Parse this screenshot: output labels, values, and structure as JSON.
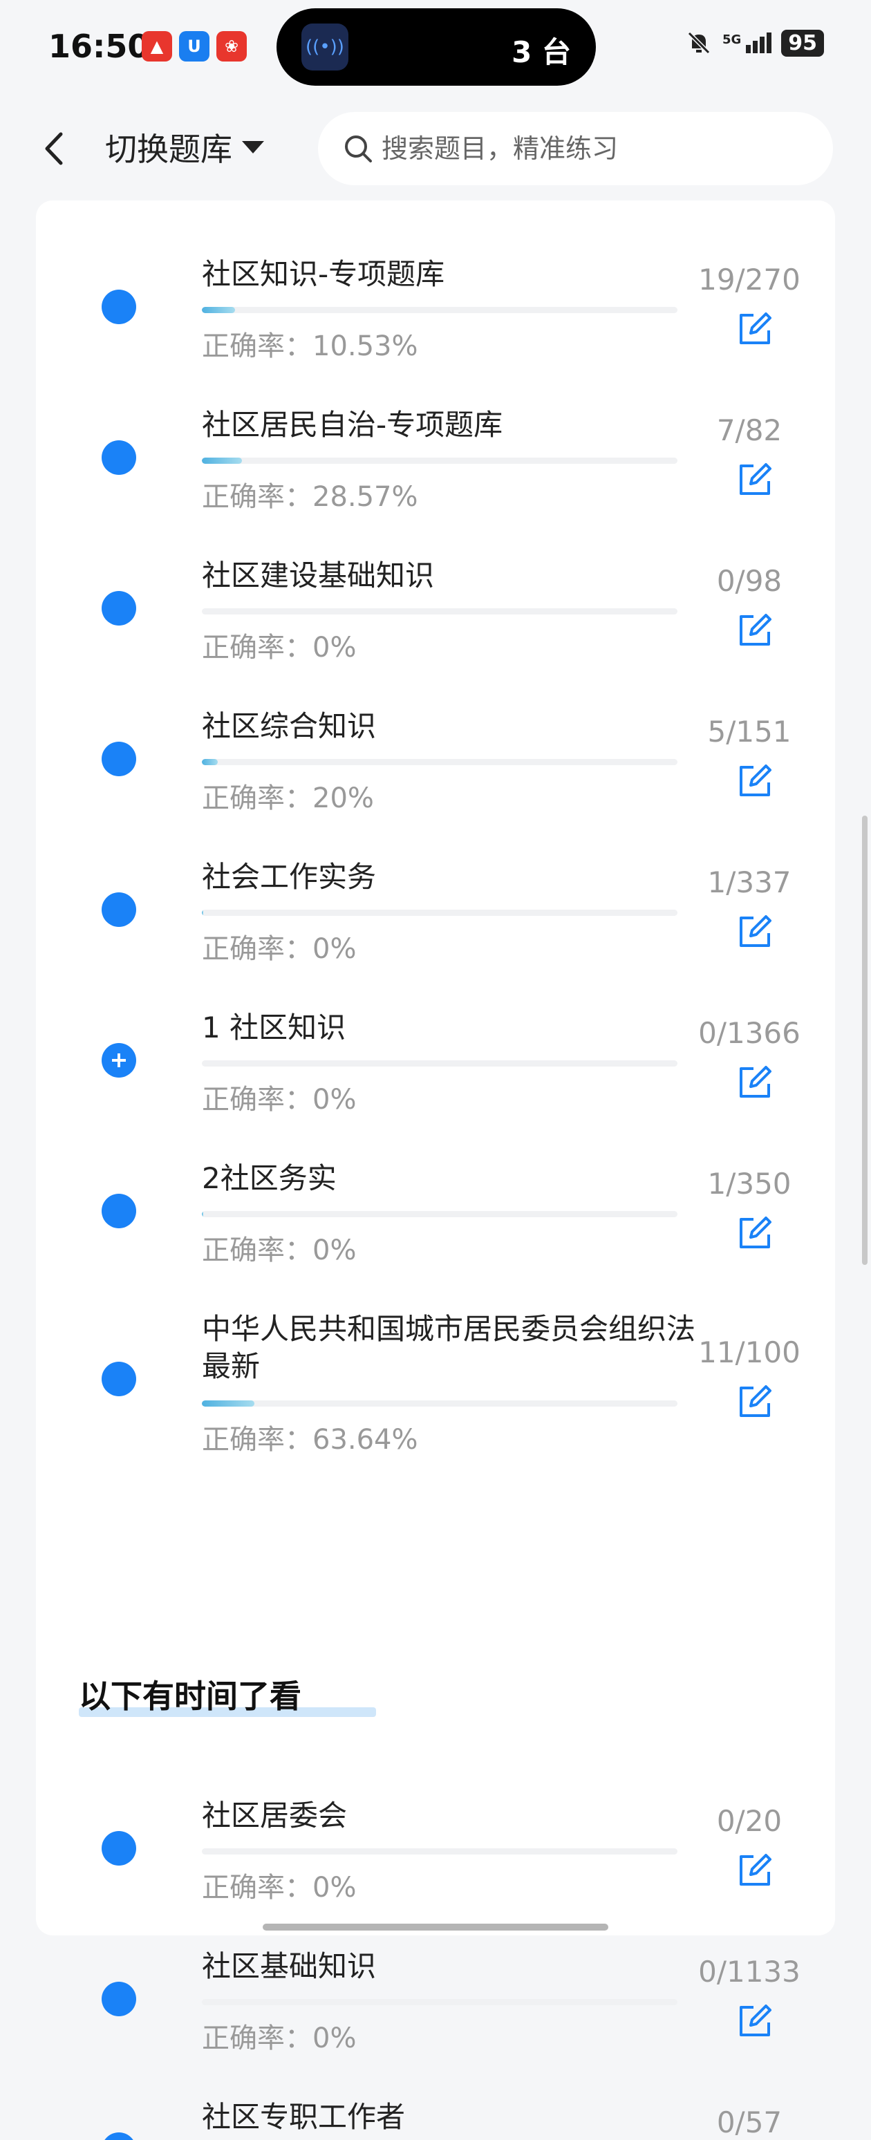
{
  "status": {
    "time": "16:50",
    "island_text": "3 台",
    "battery": "95",
    "signal": "5G"
  },
  "header": {
    "switch_label": "切换题库",
    "search_placeholder": "搜索题目，精准练习"
  },
  "banks": [
    {
      "title": "社区知识-专项题库",
      "accuracy": "正确率：10.53%",
      "count": "19/270",
      "progress": 0.07,
      "icon": "dot"
    },
    {
      "title": "社区居民自治-专项题库",
      "accuracy": "正确率：28.57%",
      "count": "7/82",
      "progress": 0.085,
      "icon": "dot"
    },
    {
      "title": "社区建设基础知识",
      "accuracy": "正确率：0%",
      "count": "0/98",
      "progress": 0,
      "icon": "dot"
    },
    {
      "title": "社区综合知识",
      "accuracy": "正确率：20%",
      "count": "5/151",
      "progress": 0.033,
      "icon": "dot"
    },
    {
      "title": "社会工作实务",
      "accuracy": "正确率：0%",
      "count": "1/337",
      "progress": 0.003,
      "icon": "dot"
    },
    {
      "title": "1 社区知识",
      "accuracy": "正确率：0%",
      "count": "0/1366",
      "progress": 0,
      "icon": "plus"
    },
    {
      "title": "2社区务实",
      "accuracy": "正确率：0%",
      "count": "1/350",
      "progress": 0.003,
      "icon": "dot"
    },
    {
      "title": "中华人民共和国城市居民委员会组织法 最新",
      "accuracy": "正确率：63.64%",
      "count": "11/100",
      "progress": 0.11,
      "icon": "dot"
    }
  ],
  "section_title": "以下有时间了看",
  "banks_later": [
    {
      "title": "社区居委会",
      "accuracy": "正确率：0%",
      "count": "0/20",
      "progress": 0,
      "icon": "dot"
    },
    {
      "title": "社区基础知识",
      "accuracy": "正确率：0%",
      "count": "0/1133",
      "progress": 0,
      "icon": "dot"
    },
    {
      "title": "社区专职工作者",
      "accuracy": "",
      "count": "0/57",
      "progress": 0,
      "icon": "dot"
    }
  ],
  "colors": {
    "accent": "#1a82f7",
    "progress": "#4fb1e0"
  }
}
